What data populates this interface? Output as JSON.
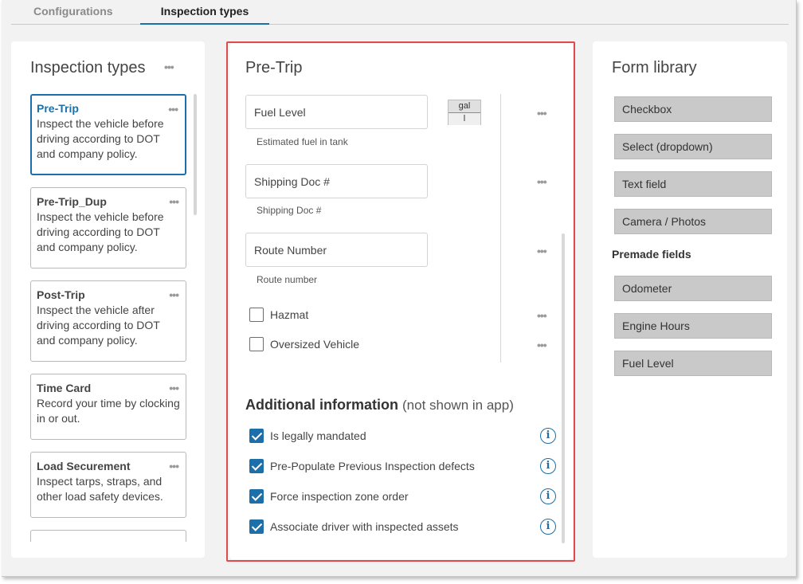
{
  "tabs": [
    {
      "label": "Configurations"
    },
    {
      "label": "Inspection types"
    }
  ],
  "left": {
    "title": "Inspection types",
    "cards": [
      {
        "title": "Pre-Trip",
        "desc": "Inspect the vehicle before driving according to DOT and company policy."
      },
      {
        "title": "Pre-Trip_Dup",
        "desc": "Inspect the vehicle before driving according to DOT and company policy."
      },
      {
        "title": "Post-Trip",
        "desc": "Inspect the vehicle after driving according to DOT and company policy."
      },
      {
        "title": "Time Card",
        "desc": "Record your time by clocking in or out."
      },
      {
        "title": "Load Securement",
        "desc": "Inspect tarps, straps, and other load safety devices."
      },
      {
        "title": "",
        "desc": ""
      }
    ]
  },
  "middle": {
    "title": "Pre-Trip",
    "fields": [
      {
        "value": "Fuel Level",
        "caption": "Estimated fuel in tank"
      },
      {
        "value": "Shipping Doc #",
        "caption": "Shipping Doc #"
      },
      {
        "value": "Route Number",
        "caption": "Route number"
      }
    ],
    "unit": {
      "top": "gal",
      "bottom": "l"
    },
    "checkboxes": [
      {
        "label": "Hazmat",
        "checked": false
      },
      {
        "label": "Oversized Vehicle",
        "checked": false
      }
    ],
    "additional": {
      "heading": "Additional information",
      "note": "(not shown in app)",
      "items": [
        {
          "label": "Is legally mandated",
          "checked": true
        },
        {
          "label": "Pre-Populate Previous Inspection defects",
          "checked": true
        },
        {
          "label": "Force inspection zone order",
          "checked": true
        },
        {
          "label": "Associate driver with inspected assets",
          "checked": true
        }
      ],
      "info_symbol": "i"
    }
  },
  "right": {
    "title": "Form library",
    "buttons": [
      "Checkbox",
      "Select (dropdown)",
      "Text field",
      "Camera / Photos"
    ],
    "premade_label": "Premade fields",
    "premade": [
      "Odometer",
      "Engine Hours",
      "Fuel Level"
    ]
  },
  "dots_glyph": "•••",
  "colors": {
    "accent": "#1c6fa8",
    "highlight": "#e2484d"
  }
}
